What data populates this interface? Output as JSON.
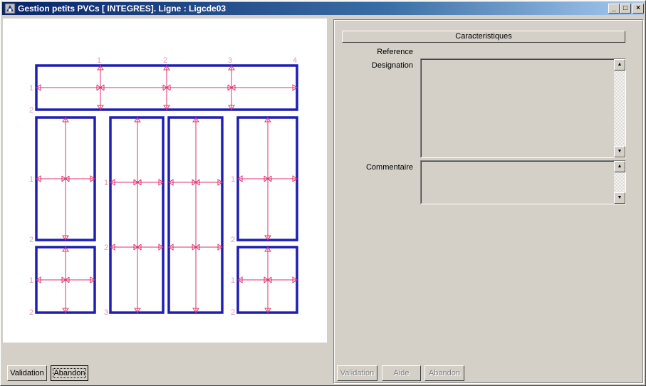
{
  "window": {
    "title": "Gestion petits PVCs [ INTEGRES]. Ligne : Ligcde03",
    "minimize_glyph": "_",
    "maximize_glyph": "□",
    "close_glyph": "×"
  },
  "canvas": {
    "frame_color": "#1e1eb4",
    "dim_color": "#e0306a",
    "label_color": "#d8a0c0",
    "top_labels": [
      "1",
      "2",
      "3",
      "4"
    ],
    "side_label": "1",
    "corner_label": "2",
    "bottom_label_3": "3"
  },
  "left_buttons": {
    "validation": "Validation",
    "abandon": "Abandon"
  },
  "right": {
    "section_title": "Caracteristiques",
    "reference_label": "Reference",
    "designation_label": "Designation",
    "commentaire_label": "Commentaire",
    "scroll_up_glyph": "▲",
    "scroll_down_glyph": "▼",
    "buttons": {
      "validation": "Validation",
      "aide": "Aide",
      "abandon": "Abandon"
    }
  }
}
